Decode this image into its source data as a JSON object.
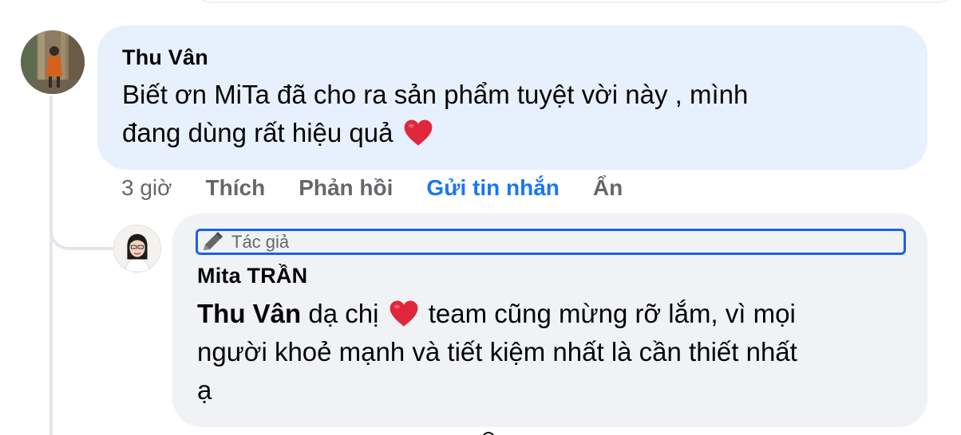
{
  "comment": {
    "author": "Thu Vân",
    "text_line1": "Biết ơn MiTa đã cho ra sản phẩm tuyệt vời này , mình",
    "text_line2": "đang dùng rất hiệu quả",
    "emoji": "heart-icon",
    "time": "3 giờ",
    "actions": {
      "like": "Thích",
      "reply": "Phản hồi",
      "message": "Gửi tin nhắn",
      "hide": "Ẩn"
    }
  },
  "reply": {
    "badge": "Tác giả",
    "author": "Mita TRẦN",
    "mention": "Thu Vân",
    "text_part1": " dạ chị ",
    "text_part2": " team cũng mừng rỡ lắm, vì mọi",
    "text_line2": "người khoẻ mạnh và tiết kiệm nhất là cần thiết nhất",
    "text_line3": "ạ"
  },
  "colors": {
    "comment_bubble": "#e7f1fd",
    "reply_bubble": "#f0f2f5",
    "link_blue": "#1877f2",
    "badge_border": "#1a61e8",
    "heart_red": "#e0263a",
    "muted_text": "#65676b"
  }
}
